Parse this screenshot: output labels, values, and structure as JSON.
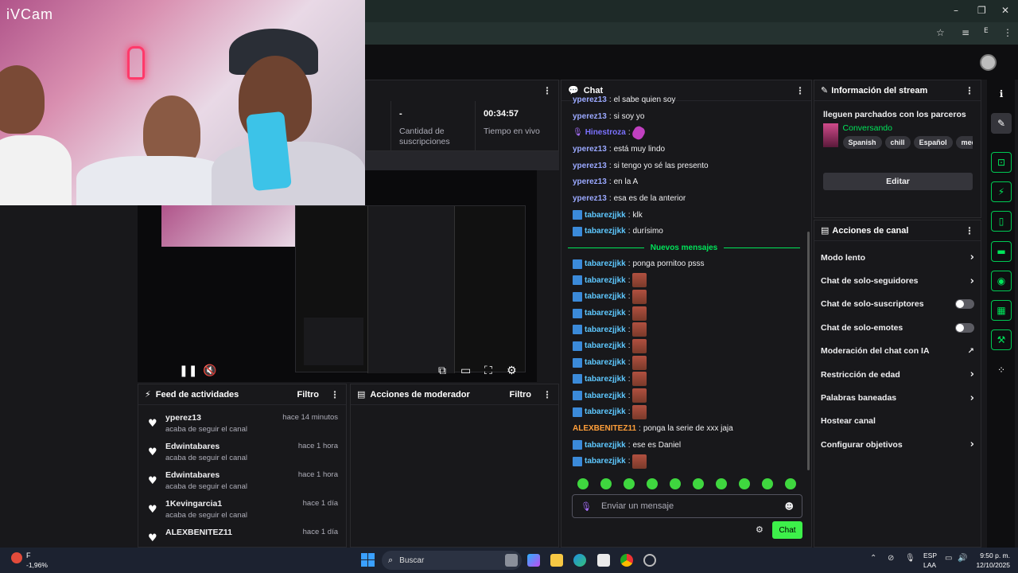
{
  "webcam": {
    "app_label": "iVCam"
  },
  "stats": [
    {
      "value": "-",
      "label": "Cantidad de suscripciones"
    },
    {
      "value": "00:34:57",
      "label": "Tiempo en vivo"
    }
  ],
  "chat": {
    "title": "Chat",
    "messages": [
      {
        "user": "yperez13",
        "color": "#9aa8ff",
        "text": "el sabe quien soy",
        "badge": false
      },
      {
        "user": "yperez13",
        "color": "#9aa8ff",
        "text": "si soy yo",
        "badge": false
      },
      {
        "user": "Hinestroza",
        "color": "#7b72ff",
        "text": "",
        "badge": false,
        "mic": true,
        "emote": "purple"
      },
      {
        "user": "yperez13",
        "color": "#9aa8ff",
        "text": "está muy lindo",
        "badge": false
      },
      {
        "user": "yperez13",
        "color": "#9aa8ff",
        "text": "si tengo yo sé las presento",
        "badge": false
      },
      {
        "user": "yperez13",
        "color": "#9aa8ff",
        "text": "en la A",
        "badge": false
      },
      {
        "user": "yperez13",
        "color": "#9aa8ff",
        "text": "esa es de la anterior",
        "badge": false
      },
      {
        "user": "tabarezjjkk",
        "color": "#5ec8ff",
        "text": "klk",
        "badge": true
      },
      {
        "user": "tabarezjjkk",
        "color": "#5ec8ff",
        "text": "durísimo",
        "badge": true
      }
    ],
    "new_messages_label": "Nuevos mensajes",
    "messages_after": [
      {
        "user": "tabarezjjkk",
        "color": "#5ec8ff",
        "text": "ponga pornitoo psss",
        "badge": true
      },
      {
        "user": "tabarezjjkk",
        "color": "#5ec8ff",
        "text": "",
        "badge": true,
        "emote": "img"
      },
      {
        "user": "tabarezjjkk",
        "color": "#5ec8ff",
        "text": "",
        "badge": true,
        "emote": "img"
      },
      {
        "user": "tabarezjjkk",
        "color": "#5ec8ff",
        "text": "",
        "badge": true,
        "emote": "img"
      },
      {
        "user": "tabarezjjkk",
        "color": "#5ec8ff",
        "text": "",
        "badge": true,
        "emote": "img"
      },
      {
        "user": "tabarezjjkk",
        "color": "#5ec8ff",
        "text": "",
        "badge": true,
        "emote": "img"
      },
      {
        "user": "tabarezjjkk",
        "color": "#5ec8ff",
        "text": "",
        "badge": true,
        "emote": "img"
      },
      {
        "user": "tabarezjjkk",
        "color": "#5ec8ff",
        "text": "",
        "badge": true,
        "emote": "img"
      },
      {
        "user": "tabarezjjkk",
        "color": "#5ec8ff",
        "text": "",
        "badge": true,
        "emote": "img"
      },
      {
        "user": "tabarezjjkk",
        "color": "#5ec8ff",
        "text": "",
        "badge": true,
        "emote": "img"
      },
      {
        "user": "ALEXBENITEZ11",
        "color": "#ff9f3a",
        "text": "ponga la serie de xxx jaja",
        "badge": false
      },
      {
        "user": "tabarezjjkk",
        "color": "#5ec8ff",
        "text": "ese es Daniel",
        "badge": true
      },
      {
        "user": "tabarezjjkk",
        "color": "#5ec8ff",
        "text": "",
        "badge": true,
        "emote": "img"
      }
    ],
    "input_placeholder": "Enviar un mensaje",
    "send_label": "Chat"
  },
  "stream_info": {
    "title": "Información del stream",
    "stream_title": "lleguen parchados con los parceros",
    "category": "Conversando",
    "tags": [
      "Spanish",
      "chill",
      "Español",
      "medelin"
    ],
    "edit_label": "Editar"
  },
  "channel_actions": {
    "title": "Acciones de canal",
    "items": [
      {
        "label": "Modo lento",
        "control": "chevron"
      },
      {
        "label": "Chat de solo-seguidores",
        "control": "chevron"
      },
      {
        "label": "Chat de solo-suscriptores",
        "control": "toggle"
      },
      {
        "label": "Chat de solo-emotes",
        "control": "toggle"
      },
      {
        "label": "Moderación del chat con IA",
        "control": "external"
      },
      {
        "label": "Restricción de edad",
        "control": "chevron"
      },
      {
        "label": "Palabras baneadas",
        "control": "chevron"
      },
      {
        "label": "Hostear canal",
        "control": "none"
      },
      {
        "label": "Configurar objetivos",
        "control": "chevron"
      }
    ]
  },
  "activity_feed": {
    "title": "Feed de actividades",
    "filter_label": "Filtro",
    "items": [
      {
        "name": "yperez13",
        "sub": "acaba de seguir el canal",
        "time": "hace 14 minutos"
      },
      {
        "name": "Edwintabares",
        "sub": "acaba de seguir el canal",
        "time": "hace 1 hora"
      },
      {
        "name": "Edwintabares",
        "sub": "acaba de seguir el canal",
        "time": "hace 1 hora"
      },
      {
        "name": "1Kevingarcia1",
        "sub": "acaba de seguir el canal",
        "time": "hace 1 día"
      },
      {
        "name": "ALEXBENITEZ11",
        "sub": "",
        "time": "hace 1 día"
      }
    ]
  },
  "mod_actions": {
    "title": "Acciones de moderador",
    "filter_label": "Filtro"
  },
  "taskbar": {
    "search_placeholder": "Buscar",
    "weather_label": "F",
    "weather_change": "-1,96%",
    "lang_top": "ESP",
    "lang_bottom": "LAA",
    "time": "9:50 p. m.",
    "date": "12/10/2025"
  },
  "colors": {
    "accent": "#00e55a",
    "bg": "#18181b",
    "send_button": "#3df04a"
  }
}
